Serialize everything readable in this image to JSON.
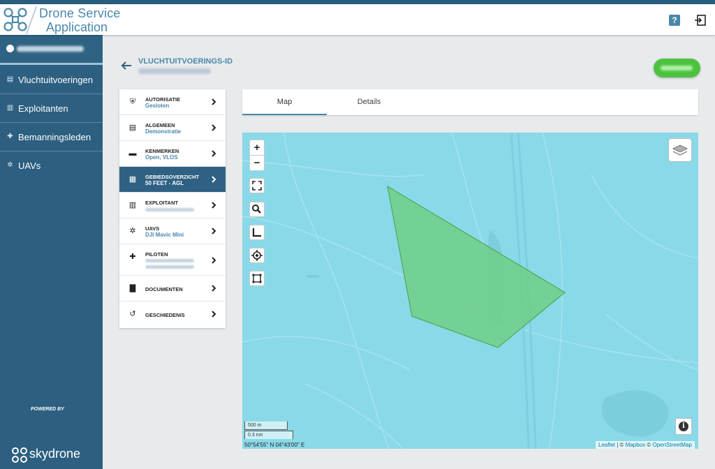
{
  "app": {
    "title_line1": "Drone Service",
    "title_line2": "Application",
    "brand_color": "#4a87ab",
    "help_label": "?"
  },
  "sidebar": {
    "items": [
      {
        "label": "Vluchtuitvoeringen",
        "icon": "document-icon"
      },
      {
        "label": "Exploitanten",
        "icon": "building-icon"
      },
      {
        "label": "Bemanningsleden",
        "icon": "person-add-icon"
      },
      {
        "label": "UAVs",
        "icon": "drone-icon"
      }
    ],
    "powered_by": "POWERED BY",
    "company": "skydrone"
  },
  "flight": {
    "title": "VLUCHTUITVOERINGS-ID"
  },
  "menu": [
    {
      "title": "AUTORISATIE",
      "subtitle": "Gesloten",
      "icon": "shield-icon"
    },
    {
      "title": "ALGEMEEN",
      "subtitle": "Demonstratie",
      "icon": "form-icon"
    },
    {
      "title": "KENMERKEN",
      "subtitle": "Open, VLOS",
      "icon": "folder-icon"
    },
    {
      "title": "GEBIEDSOVERZICHT",
      "subtitle": "50 FEET - AGL",
      "icon": "map-icon",
      "active": true
    },
    {
      "title": "EXPLOITANT",
      "subtitle": "",
      "icon": "building-icon"
    },
    {
      "title": "UAVS",
      "subtitle": "DJI Mavic Mini",
      "icon": "drone-icon"
    },
    {
      "title": "PILOTEN",
      "subtitle": "",
      "icon": "person-add-icon"
    },
    {
      "title": "DOCUMENTEN",
      "subtitle": "",
      "icon": "file-icon"
    },
    {
      "title": "GESCHIEDENIS",
      "subtitle": "",
      "icon": "history-icon"
    }
  ],
  "tabs": [
    {
      "label": "Map",
      "active": true
    },
    {
      "label": "Details",
      "active": false
    }
  ],
  "map": {
    "zoom_in": "+",
    "zoom_out": "−",
    "scale_metric": "500 m",
    "scale_nautical": "0.3 nm",
    "coordinates": "50°54'55\" N 04°43'00\" E",
    "attribution": {
      "leaflet": "Leaflet",
      "sep": " | © ",
      "mapbox": "Mapbox",
      "sep2": " © ",
      "osm": "OpenStreetMap"
    },
    "street_label": "Herent",
    "polygon_color": "#6fcf86",
    "water_color": "#8ad9e8"
  },
  "colors": {
    "sidebar": "#2c5f80",
    "accent": "#4a87ab",
    "status_green": "#4cc23f"
  }
}
